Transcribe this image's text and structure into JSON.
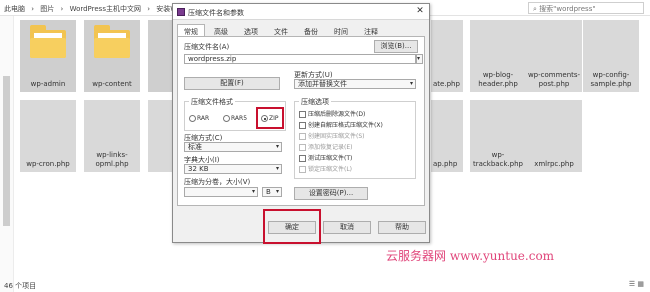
{
  "explorer": {
    "breadcrumbs": [
      "此电脑",
      "图片",
      "WordPress主机中文网",
      "安装W"
    ],
    "search_placeholder": "搜索\"wordpress\"",
    "status": "46 个项目",
    "tiles": [
      {
        "label": "wp-admin",
        "kind": "folder"
      },
      {
        "label": "wp-content",
        "kind": "folder"
      },
      {
        "label": "",
        "kind": "folder"
      },
      {
        "label": "ate.php",
        "kind": "file"
      },
      {
        "label": "wp-blog-header.php",
        "kind": "file"
      },
      {
        "label": "wp-comments-post.php",
        "kind": "file"
      },
      {
        "label": "wp-config-sample.php",
        "kind": "file"
      },
      {
        "label": "wp-cron.php",
        "kind": "file"
      },
      {
        "label": "wp-links-opml.php",
        "kind": "file"
      },
      {
        "label": "",
        "kind": "file"
      },
      {
        "label": "ap.php",
        "kind": "file"
      },
      {
        "label": "wp-trackback.php",
        "kind": "file"
      },
      {
        "label": "xmlrpc.php",
        "kind": "file"
      }
    ]
  },
  "dialog": {
    "title": "压缩文件名和参数",
    "tabs": [
      "常规",
      "高级",
      "选项",
      "文件",
      "备份",
      "时间",
      "注释"
    ],
    "archive_name_label": "压缩文件名(A)",
    "browse_button": "浏览(B)...",
    "archive_name_value": "wordpress.zip",
    "config_button": "配置(F)",
    "update_mode_label": "更新方式(U)",
    "update_mode_value": "添加并替换文件",
    "format_group_title": "压缩文件格式",
    "formats": [
      "RAR",
      "RAR5",
      "ZIP"
    ],
    "selected_format": "ZIP",
    "method_label": "压缩方式(C)",
    "method_value": "标准",
    "dict_label": "字典大小(I)",
    "dict_value": "32 KB",
    "split_label": "压缩为分卷，大小(V)",
    "split_unit": "B",
    "options_group_title": "压缩选项",
    "options": [
      {
        "label": "压缩后删除源文件(D)",
        "enabled": true
      },
      {
        "label": "创建自解压格式压缩文件(X)",
        "enabled": true
      },
      {
        "label": "创建固实压缩文件(S)",
        "enabled": false
      },
      {
        "label": "添加恢复记录(E)",
        "enabled": false
      },
      {
        "label": "测试压缩文件(T)",
        "enabled": true
      },
      {
        "label": "锁定压缩文件(L)",
        "enabled": false
      }
    ],
    "password_button": "设置密码(P)...",
    "ok_button": "确定",
    "cancel_button": "取消",
    "help_button": "帮助"
  },
  "watermark": "云服务器网 www.yuntue.com",
  "colors": {
    "highlight": "#c8102e",
    "folder": "#f2c451",
    "watermark": "#e0457a"
  }
}
